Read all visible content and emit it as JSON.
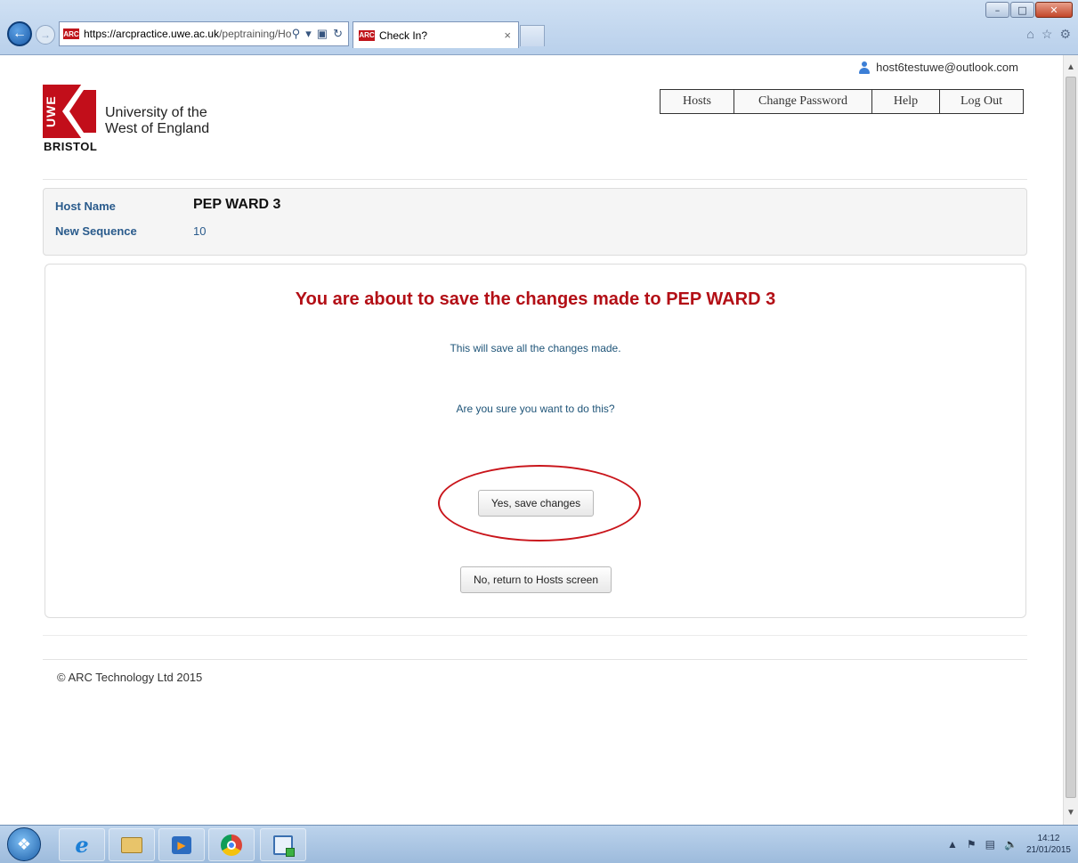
{
  "browser": {
    "url_host": "https://arcpractice.uwe.ac.uk",
    "url_path": "/peptraining/Ho",
    "tab_title": "Check In?",
    "tab_close": "×",
    "favicon_text": "ARC"
  },
  "header": {
    "user_email": "host6testuwe@outlook.com",
    "logo": {
      "mark_text": "UWE",
      "name_line1": "University of the",
      "name_line2": "West of England",
      "city": "BRISTOL"
    },
    "menu": {
      "hosts": "Hosts",
      "change_password": "Change Password",
      "help": "Help",
      "logout": "Log Out"
    }
  },
  "host_info": {
    "host_name_label": "Host Name",
    "host_name_value": "PEP WARD 3",
    "sequence_label": "New Sequence",
    "sequence_value": "10"
  },
  "confirm": {
    "title": "You are about to save the changes made to PEP WARD 3",
    "message": "This will save all the changes made.",
    "question": "Are you sure you want to do this?",
    "yes_button": "Yes, save changes",
    "no_button": "No, return to Hosts screen",
    "highlight_color": "#c9151b"
  },
  "footer": {
    "copyright": "© ARC Technology Ltd 2015"
  },
  "taskbar": {
    "time": "14:12",
    "date": "21/01/2015"
  },
  "colors": {
    "title_red": "#b30f16",
    "label_blue": "#2a5b8c",
    "brand_red": "#c20e1a"
  }
}
